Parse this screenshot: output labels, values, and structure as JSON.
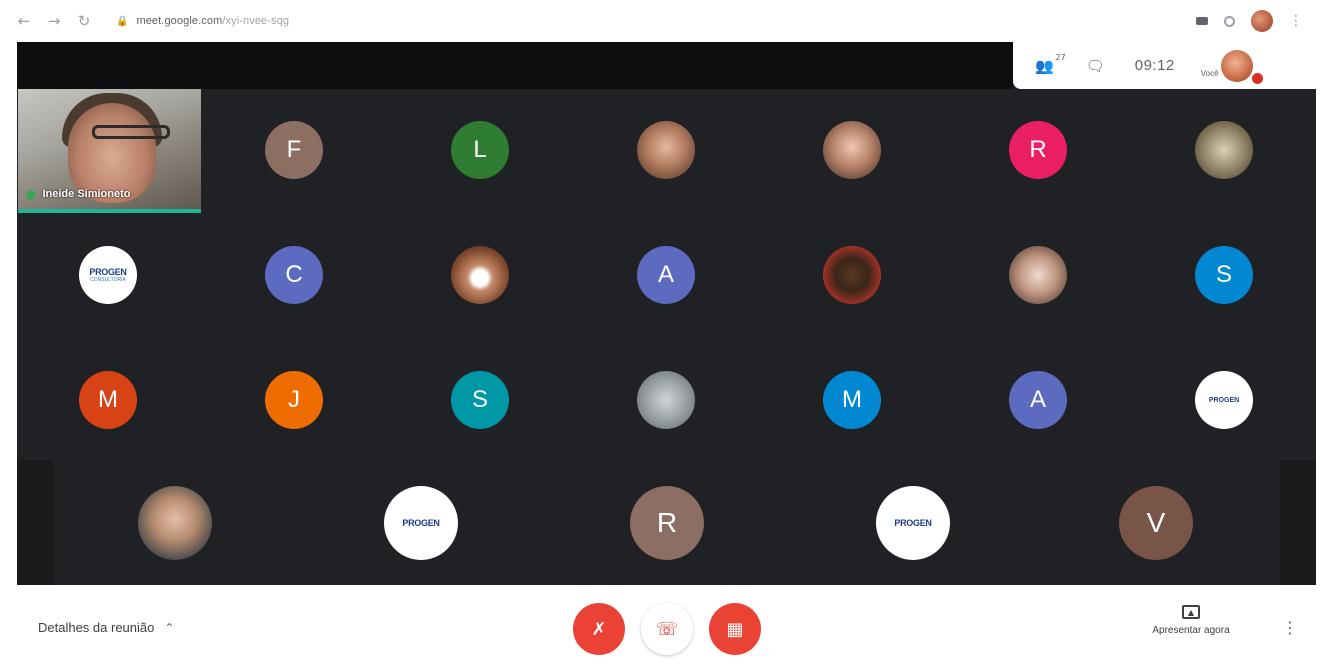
{
  "browser": {
    "back_icon": "arrow-left-icon",
    "forward_icon": "arrow-right-icon",
    "reload_icon": "reload-icon",
    "url_host": "meet.google.com",
    "url_path": "/xyi-nvee-sqg"
  },
  "meet": {
    "people_count": "27",
    "time": "09:12",
    "you_label": "Você"
  },
  "presenter": {
    "name": "Ineide Simioneto"
  },
  "participants": {
    "row1": [
      {
        "initial": "F",
        "color": "#8d6e63"
      },
      {
        "initial": "L",
        "color": "#2e7d32"
      },
      {
        "photo": "photo-a"
      },
      {
        "photo": "photo-b"
      },
      {
        "initial": "R",
        "color": "#e91e63"
      },
      {
        "photo": "photo-c"
      }
    ],
    "row2": [
      {
        "logo": "PROGEN",
        "logo_sub": "CONSULTORIA"
      },
      {
        "initial": "C",
        "color": "#5c6bc0"
      },
      {
        "photo": "photo-d"
      },
      {
        "initial": "A",
        "color": "#5c6bc0"
      },
      {
        "photo": "photo-e"
      },
      {
        "photo": "photo-f"
      },
      {
        "initial": "S",
        "color": "#0288d1"
      }
    ],
    "row3": [
      {
        "initial": "M",
        "color": "#d84315"
      },
      {
        "initial": "J",
        "color": "#ef6c00"
      },
      {
        "initial": "S",
        "color": "#0097a7"
      },
      {
        "photo": "photo-g"
      },
      {
        "initial": "M",
        "color": "#0288d1"
      },
      {
        "initial": "A",
        "color": "#5c6bc0"
      },
      {
        "logo": "PROGEN"
      }
    ],
    "row4": [
      {
        "photo": "photo-h"
      },
      {
        "logo": "PROGEN"
      },
      {
        "initial": "R",
        "color": "#8d6e63"
      },
      {
        "logo": "PROGEN"
      },
      {
        "initial": "V",
        "color": "#795548"
      }
    ]
  },
  "controls": {
    "details_label": "Detalhes da reunião",
    "present_label": "Apresentar agora",
    "mic_icon": "mic-off-icon",
    "hangup_icon": "phone-hangup-icon",
    "camera_icon": "camera-off-icon"
  },
  "colors": {
    "stage_bg": "#202124",
    "control_red": "#ea4335",
    "speaking_bar": "#20b59a"
  }
}
